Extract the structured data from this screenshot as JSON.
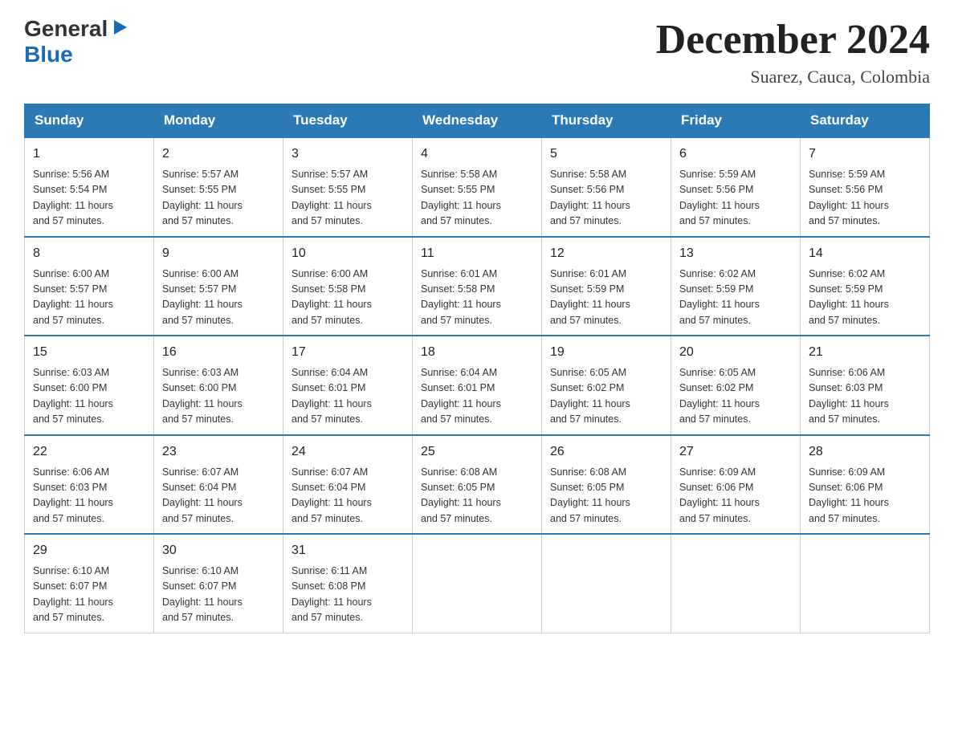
{
  "header": {
    "logo_general": "General",
    "logo_blue": "Blue",
    "month_title": "December 2024",
    "location": "Suarez, Cauca, Colombia"
  },
  "days_of_week": [
    "Sunday",
    "Monday",
    "Tuesday",
    "Wednesday",
    "Thursday",
    "Friday",
    "Saturday"
  ],
  "weeks": [
    [
      {
        "day": "1",
        "sunrise": "5:56 AM",
        "sunset": "5:54 PM",
        "daylight": "11 hours and 57 minutes."
      },
      {
        "day": "2",
        "sunrise": "5:57 AM",
        "sunset": "5:55 PM",
        "daylight": "11 hours and 57 minutes."
      },
      {
        "day": "3",
        "sunrise": "5:57 AM",
        "sunset": "5:55 PM",
        "daylight": "11 hours and 57 minutes."
      },
      {
        "day": "4",
        "sunrise": "5:58 AM",
        "sunset": "5:55 PM",
        "daylight": "11 hours and 57 minutes."
      },
      {
        "day": "5",
        "sunrise": "5:58 AM",
        "sunset": "5:56 PM",
        "daylight": "11 hours and 57 minutes."
      },
      {
        "day": "6",
        "sunrise": "5:59 AM",
        "sunset": "5:56 PM",
        "daylight": "11 hours and 57 minutes."
      },
      {
        "day": "7",
        "sunrise": "5:59 AM",
        "sunset": "5:56 PM",
        "daylight": "11 hours and 57 minutes."
      }
    ],
    [
      {
        "day": "8",
        "sunrise": "6:00 AM",
        "sunset": "5:57 PM",
        "daylight": "11 hours and 57 minutes."
      },
      {
        "day": "9",
        "sunrise": "6:00 AM",
        "sunset": "5:57 PM",
        "daylight": "11 hours and 57 minutes."
      },
      {
        "day": "10",
        "sunrise": "6:00 AM",
        "sunset": "5:58 PM",
        "daylight": "11 hours and 57 minutes."
      },
      {
        "day": "11",
        "sunrise": "6:01 AM",
        "sunset": "5:58 PM",
        "daylight": "11 hours and 57 minutes."
      },
      {
        "day": "12",
        "sunrise": "6:01 AM",
        "sunset": "5:59 PM",
        "daylight": "11 hours and 57 minutes."
      },
      {
        "day": "13",
        "sunrise": "6:02 AM",
        "sunset": "5:59 PM",
        "daylight": "11 hours and 57 minutes."
      },
      {
        "day": "14",
        "sunrise": "6:02 AM",
        "sunset": "5:59 PM",
        "daylight": "11 hours and 57 minutes."
      }
    ],
    [
      {
        "day": "15",
        "sunrise": "6:03 AM",
        "sunset": "6:00 PM",
        "daylight": "11 hours and 57 minutes."
      },
      {
        "day": "16",
        "sunrise": "6:03 AM",
        "sunset": "6:00 PM",
        "daylight": "11 hours and 57 minutes."
      },
      {
        "day": "17",
        "sunrise": "6:04 AM",
        "sunset": "6:01 PM",
        "daylight": "11 hours and 57 minutes."
      },
      {
        "day": "18",
        "sunrise": "6:04 AM",
        "sunset": "6:01 PM",
        "daylight": "11 hours and 57 minutes."
      },
      {
        "day": "19",
        "sunrise": "6:05 AM",
        "sunset": "6:02 PM",
        "daylight": "11 hours and 57 minutes."
      },
      {
        "day": "20",
        "sunrise": "6:05 AM",
        "sunset": "6:02 PM",
        "daylight": "11 hours and 57 minutes."
      },
      {
        "day": "21",
        "sunrise": "6:06 AM",
        "sunset": "6:03 PM",
        "daylight": "11 hours and 57 minutes."
      }
    ],
    [
      {
        "day": "22",
        "sunrise": "6:06 AM",
        "sunset": "6:03 PM",
        "daylight": "11 hours and 57 minutes."
      },
      {
        "day": "23",
        "sunrise": "6:07 AM",
        "sunset": "6:04 PM",
        "daylight": "11 hours and 57 minutes."
      },
      {
        "day": "24",
        "sunrise": "6:07 AM",
        "sunset": "6:04 PM",
        "daylight": "11 hours and 57 minutes."
      },
      {
        "day": "25",
        "sunrise": "6:08 AM",
        "sunset": "6:05 PM",
        "daylight": "11 hours and 57 minutes."
      },
      {
        "day": "26",
        "sunrise": "6:08 AM",
        "sunset": "6:05 PM",
        "daylight": "11 hours and 57 minutes."
      },
      {
        "day": "27",
        "sunrise": "6:09 AM",
        "sunset": "6:06 PM",
        "daylight": "11 hours and 57 minutes."
      },
      {
        "day": "28",
        "sunrise": "6:09 AM",
        "sunset": "6:06 PM",
        "daylight": "11 hours and 57 minutes."
      }
    ],
    [
      {
        "day": "29",
        "sunrise": "6:10 AM",
        "sunset": "6:07 PM",
        "daylight": "11 hours and 57 minutes."
      },
      {
        "day": "30",
        "sunrise": "6:10 AM",
        "sunset": "6:07 PM",
        "daylight": "11 hours and 57 minutes."
      },
      {
        "day": "31",
        "sunrise": "6:11 AM",
        "sunset": "6:08 PM",
        "daylight": "11 hours and 57 minutes."
      },
      null,
      null,
      null,
      null
    ]
  ],
  "labels": {
    "sunrise": "Sunrise:",
    "sunset": "Sunset:",
    "daylight": "Daylight:"
  }
}
